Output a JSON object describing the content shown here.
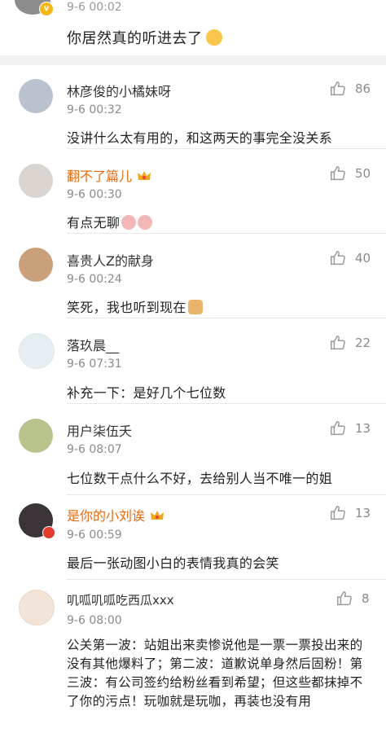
{
  "top": {
    "time": "9-6 00:02",
    "text": "你居然真的听进去了",
    "badge": "v"
  },
  "comments": [
    {
      "author": "林彦俊的小橘妹呀",
      "vip": false,
      "time": "9-6 00:32",
      "text": "没讲什么太有用的，和这两天的事完全没关系",
      "likes": "86",
      "avatar_color": "#b9c3cf"
    },
    {
      "author": "翻不了篇儿",
      "vip": true,
      "time": "9-6 00:30",
      "text": "有点无聊",
      "likes": "50",
      "avatar_color": "#d9d4cf"
    },
    {
      "author": "喜贵人Z的献身",
      "vip": false,
      "time": "9-6 00:24",
      "text": "笑死，我也听到现在",
      "likes": "40",
      "avatar_color": "#c9a07a"
    },
    {
      "author": "落玖晨__",
      "vip": false,
      "time": "9-6 07:31",
      "text": "补充一下：是好几个七位数",
      "likes": "22",
      "avatar_color": "#e7eef2"
    },
    {
      "author": "用户柒伍夭",
      "vip": false,
      "time": "9-6 08:07",
      "text": "七位数干点什么不好，去给别人当不唯一的姐",
      "likes": "13",
      "avatar_color": "#b9c48c"
    },
    {
      "author": "是你的小刘诶",
      "vip": true,
      "time": "9-6 00:59",
      "text": "最后一张动图小白的表情我真的会笑",
      "likes": "13",
      "avatar_color": "#3a3438"
    },
    {
      "author": "叽呱叽呱吃西瓜xxx",
      "vip": false,
      "time": "9-6 08:00",
      "text": "公关第一波：站姐出来卖惨说他是一票一票投出来的没有其他爆料了；第二波：道歉说单身然后固粉！第三波：有公司签约给粉丝看到希望；但这些都抹掉不了你的污点！玩咖就是玩咖，再装也没有用",
      "likes": "8",
      "avatar_color": "#f2e4d8"
    }
  ],
  "colors": {
    "vip_name": "#e86b0f",
    "like_icon": "#9a9a9a",
    "separator": "#f2f2f2"
  }
}
